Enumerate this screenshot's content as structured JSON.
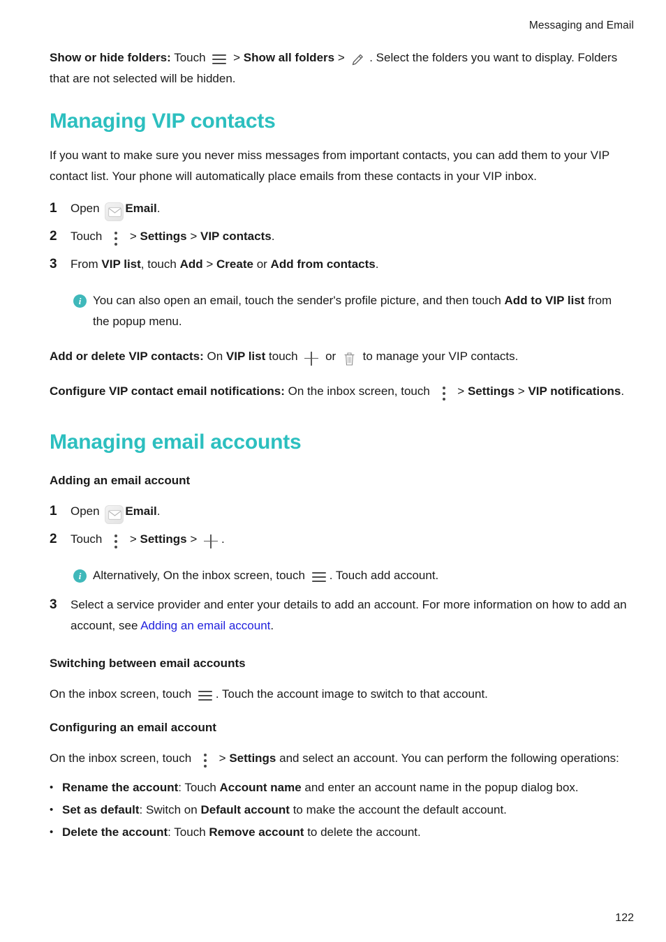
{
  "header": {
    "running_title": "Messaging and Email"
  },
  "intro": {
    "label": "Show or hide folders:",
    "text_1": "Touch",
    "icon_1": "hamburger-icon",
    "gt_1": ">",
    "bold_1": "Show all folders",
    "gt_2": ">",
    "icon_2": "pencil-icon",
    "text_2": ". Select the folders you want to display. Folders that are not selected will be hidden."
  },
  "vip_section": {
    "title": "Managing VIP contacts",
    "paragraph": "If you want to make sure you never miss messages from important contacts, you can add them to your VIP contact list. Your phone will automatically place emails from these contacts in your VIP inbox.",
    "steps": [
      {
        "num": "1",
        "pre": "Open",
        "icon": "email-app-icon",
        "bold": "Email",
        "post": "."
      },
      {
        "num": "2",
        "pre": "Touch",
        "icon": "kebab-menu-icon",
        "gt_1": ">",
        "bold_1": "Settings",
        "gt_2": ">",
        "bold_2": "VIP contacts",
        "post": "."
      },
      {
        "num": "3",
        "pre": "From",
        "bold_1": "VIP list",
        "mid_1": ", touch",
        "bold_2": "Add",
        "gt_1": ">",
        "bold_3": "Create",
        "mid_2": "or",
        "bold_4": "Add from contacts",
        "post": "."
      }
    ],
    "note": {
      "icon": "info-icon",
      "pre": "You can also open an email, touch the sender's profile picture, and then touch",
      "bold": "Add to VIP list",
      "post": "from the popup menu."
    },
    "add_delete": {
      "label": "Add or delete VIP contacts:",
      "pre": "On",
      "bold": "VIP list",
      "mid": "touch",
      "icon_1": "plus-icon",
      "or": "or",
      "icon_2": "trash-icon",
      "post": "to manage your VIP contacts."
    },
    "configure": {
      "label": "Configure VIP contact email notifications:",
      "pre": "On the inbox screen, touch",
      "icon": "kebab-menu-icon",
      "gt_1": ">",
      "bold_1": "Settings",
      "gt_2": ">",
      "bold_2": "VIP notifications",
      "post": "."
    }
  },
  "accounts_section": {
    "title": "Managing email accounts",
    "adding": {
      "subtitle": "Adding an email account",
      "steps": [
        {
          "num": "1",
          "pre": "Open",
          "icon": "email-app-icon",
          "bold": "Email",
          "post": "."
        },
        {
          "num": "2",
          "pre": "Touch",
          "icon_1": "kebab-menu-icon",
          "gt_1": ">",
          "bold_1": "Settings",
          "gt_2": ">",
          "icon_2": "plus-icon",
          "post": "."
        },
        {
          "num": "3",
          "pre": "Select a service provider and enter your details to add an account. For more information on how to add an account, see",
          "link": "Adding an email account",
          "post": "."
        }
      ],
      "note": {
        "icon": "info-icon",
        "pre": "Alternatively, On the inbox screen, touch",
        "icon_inline": "hamburger-icon",
        "post": ". Touch add account."
      }
    },
    "switching": {
      "subtitle": "Switching between email accounts",
      "pre": "On the inbox screen, touch",
      "icon": "hamburger-icon",
      "post": ". Touch the account image to switch to that account."
    },
    "configuring": {
      "subtitle": "Configuring an email account",
      "pre": "On the inbox screen, touch",
      "icon": "kebab-menu-icon",
      "gt": ">",
      "bold": "Settings",
      "post": "and select an account. You can perform the following operations:",
      "bullets": [
        {
          "dot": "•",
          "bold_1": "Rename the account",
          "mid_1": ": Touch",
          "bold_2": "Account name",
          "post": "and enter an account name in the popup dialog box."
        },
        {
          "dot": "•",
          "bold_1": "Set as default",
          "mid_1": ": Switch on",
          "bold_2": "Default account",
          "post": "to make the account the default account."
        },
        {
          "dot": "•",
          "bold_1": "Delete the account",
          "mid_1": ": Touch",
          "bold_2": "Remove account",
          "post": "to delete the account."
        }
      ]
    }
  },
  "footer": {
    "page_number": "122"
  },
  "colors": {
    "heading_teal": "#2cbfbf",
    "info_badge_teal": "#3fb8ba",
    "link_blue": "#2222dd",
    "body_text": "#1a1a1a"
  }
}
